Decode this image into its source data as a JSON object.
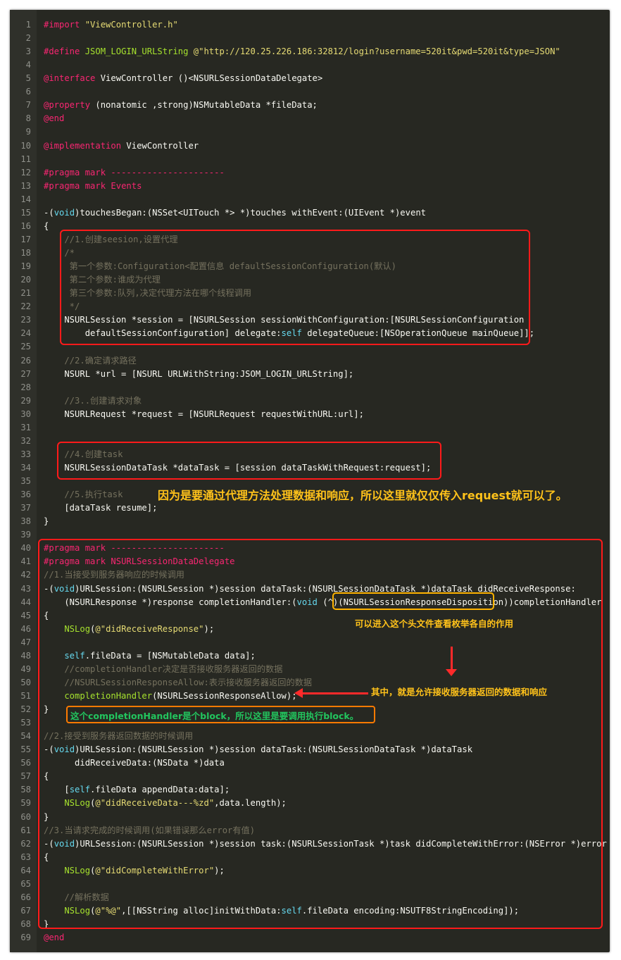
{
  "editor": {
    "theme_colors": {
      "background": "#272822",
      "preprocessor": "#f92672",
      "string": "#e6db74",
      "comment": "#75715e",
      "type": "#66d9ef",
      "function": "#a6e22e",
      "plain": "#f8f8f2"
    },
    "lines": [
      {
        "n": "1",
        "segs": [
          {
            "c": "t-pre",
            "t": "#import "
          },
          {
            "c": "t-str",
            "t": "\"ViewController.h\""
          }
        ]
      },
      {
        "n": "2",
        "segs": []
      },
      {
        "n": "3",
        "segs": [
          {
            "c": "t-pre",
            "t": "#define "
          },
          {
            "c": "t-fn",
            "t": "JSOM_LOGIN_URLString "
          },
          {
            "c": "t-str",
            "t": "@\"http://120.25.226.186:32812/login?username=520it&pwd=520it&type=JSON\""
          }
        ]
      },
      {
        "n": "4",
        "segs": []
      },
      {
        "n": "5",
        "segs": [
          {
            "c": "t-kw",
            "t": "@interface"
          },
          {
            "c": "t-plain",
            "t": " ViewController ()<NSURLSessionDataDelegate>"
          }
        ]
      },
      {
        "n": "6",
        "segs": []
      },
      {
        "n": "7",
        "segs": [
          {
            "c": "t-kw",
            "t": "@property"
          },
          {
            "c": "t-plain",
            "t": " (nonatomic ,strong)NSMutableData *fileData;"
          }
        ]
      },
      {
        "n": "8",
        "segs": [
          {
            "c": "t-kw",
            "t": "@end"
          }
        ]
      },
      {
        "n": "9",
        "segs": []
      },
      {
        "n": "10",
        "segs": [
          {
            "c": "t-kw",
            "t": "@implementation"
          },
          {
            "c": "t-plain",
            "t": " ViewController"
          }
        ]
      },
      {
        "n": "11",
        "segs": []
      },
      {
        "n": "12",
        "segs": [
          {
            "c": "t-pre",
            "t": "#pragma "
          },
          {
            "c": "t-kw",
            "t": "mark ----------------------"
          }
        ]
      },
      {
        "n": "13",
        "segs": [
          {
            "c": "t-pre",
            "t": "#pragma "
          },
          {
            "c": "t-kw",
            "t": "mark Events"
          }
        ]
      },
      {
        "n": "14",
        "segs": []
      },
      {
        "n": "15",
        "segs": [
          {
            "c": "t-plain",
            "t": "-("
          },
          {
            "c": "t-type",
            "t": "void"
          },
          {
            "c": "t-plain",
            "t": ")touchesBegan:(NSSet<UITouch *> *)touches withEvent:(UIEvent *)event"
          }
        ]
      },
      {
        "n": "16",
        "segs": [
          {
            "c": "t-plain",
            "t": "{"
          }
        ]
      },
      {
        "n": "17",
        "segs": [
          {
            "c": "t-com",
            "t": "    //1.创建seesion,设置代理"
          }
        ]
      },
      {
        "n": "18",
        "segs": [
          {
            "c": "t-com",
            "t": "    /*"
          }
        ]
      },
      {
        "n": "19",
        "segs": [
          {
            "c": "t-com",
            "t": "     第一个参数:Configuration<配置信息 defaultSessionConfiguration(默认)"
          }
        ]
      },
      {
        "n": "20",
        "segs": [
          {
            "c": "t-com",
            "t": "     第二个参数:谁成为代理"
          }
        ]
      },
      {
        "n": "21",
        "segs": [
          {
            "c": "t-com",
            "t": "     第三个参数:队列,决定代理方法在哪个线程调用"
          }
        ]
      },
      {
        "n": "22",
        "segs": [
          {
            "c": "t-com",
            "t": "     */"
          }
        ]
      },
      {
        "n": "23",
        "segs": [
          {
            "c": "t-plain",
            "t": "    NSURLSession *session = [NSURLSession sessionWithConfiguration:[NSURLSessionConfiguration"
          }
        ]
      },
      {
        "n": "24",
        "segs": [
          {
            "c": "t-plain",
            "t": "        defaultSessionConfiguration] delegate:"
          },
          {
            "c": "t-type",
            "t": "self"
          },
          {
            "c": "t-plain",
            "t": " delegateQueue:[NSOperationQueue mainQueue]];"
          }
        ]
      },
      {
        "n": "25",
        "segs": []
      },
      {
        "n": "26",
        "segs": [
          {
            "c": "t-com",
            "t": "    //2.确定请求路径"
          }
        ]
      },
      {
        "n": "27",
        "segs": [
          {
            "c": "t-plain",
            "t": "    NSURL *url = [NSURL URLWithString:JSOM_LOGIN_URLString];"
          }
        ]
      },
      {
        "n": "28",
        "segs": []
      },
      {
        "n": "29",
        "segs": [
          {
            "c": "t-com",
            "t": "    //3..创建请求对象"
          }
        ]
      },
      {
        "n": "30",
        "segs": [
          {
            "c": "t-plain",
            "t": "    NSURLRequest *request = [NSURLRequest requestWithURL:url];"
          }
        ]
      },
      {
        "n": "31",
        "segs": []
      },
      {
        "n": "32",
        "segs": []
      },
      {
        "n": "33",
        "segs": [
          {
            "c": "t-com",
            "t": "    //4.创建task"
          }
        ]
      },
      {
        "n": "34",
        "segs": [
          {
            "c": "t-plain",
            "t": "    NSURLSessionDataTask *dataTask = [session dataTaskWithRequest:request];"
          }
        ]
      },
      {
        "n": "35",
        "segs": []
      },
      {
        "n": "36",
        "segs": [
          {
            "c": "t-com",
            "t": "    //5.执行task"
          }
        ]
      },
      {
        "n": "37",
        "segs": [
          {
            "c": "t-plain",
            "t": "    [dataTask resume];"
          }
        ]
      },
      {
        "n": "38",
        "segs": [
          {
            "c": "t-plain",
            "t": "}"
          }
        ]
      },
      {
        "n": "39",
        "segs": []
      },
      {
        "n": "40",
        "segs": [
          {
            "c": "t-pre",
            "t": "#pragma "
          },
          {
            "c": "t-kw",
            "t": "mark ----------------------"
          }
        ]
      },
      {
        "n": "41",
        "segs": [
          {
            "c": "t-pre",
            "t": "#pragma "
          },
          {
            "c": "t-kw",
            "t": "mark NSURLSessionDataDelegate"
          }
        ]
      },
      {
        "n": "42",
        "segs": [
          {
            "c": "t-com",
            "t": "//1.当接受到服务器响应的时候调用"
          }
        ]
      },
      {
        "n": "43",
        "segs": [
          {
            "c": "t-plain",
            "t": "-("
          },
          {
            "c": "t-type",
            "t": "void"
          },
          {
            "c": "t-plain",
            "t": ")URLSession:(NSURLSession *)session dataTask:(NSURLSessionDataTask *)dataTask didReceiveResponse:"
          }
        ]
      },
      {
        "n": "44",
        "segs": [
          {
            "c": "t-plain",
            "t": "    (NSURLResponse *)response completionHandler:("
          },
          {
            "c": "t-type",
            "t": "void"
          },
          {
            "c": "t-plain",
            "t": " (^)(NSURLSessionResponseDisposition))completionHandler"
          }
        ]
      },
      {
        "n": "45",
        "segs": [
          {
            "c": "t-plain",
            "t": "{"
          }
        ]
      },
      {
        "n": "46",
        "segs": [
          {
            "c": "t-fn",
            "t": "    NSLog"
          },
          {
            "c": "t-plain",
            "t": "("
          },
          {
            "c": "t-str",
            "t": "@\"didReceiveResponse\""
          },
          {
            "c": "t-plain",
            "t": ");"
          }
        ]
      },
      {
        "n": "47",
        "segs": []
      },
      {
        "n": "48",
        "segs": [
          {
            "c": "t-type",
            "t": "    self"
          },
          {
            "c": "t-plain",
            "t": ".fileData = [NSMutableData data];"
          }
        ]
      },
      {
        "n": "49",
        "segs": [
          {
            "c": "t-com",
            "t": "    //completionHandler决定是否接收服务器返回的数据"
          }
        ]
      },
      {
        "n": "50",
        "segs": [
          {
            "c": "t-com",
            "t": "    //NSURLSessionResponseAllow:表示接收服务器返回的数据"
          }
        ]
      },
      {
        "n": "51",
        "segs": [
          {
            "c": "t-fn",
            "t": "    completionHandler"
          },
          {
            "c": "t-plain",
            "t": "(NSURLSessionResponseAllow);"
          }
        ]
      },
      {
        "n": "52",
        "segs": [
          {
            "c": "t-plain",
            "t": "}"
          }
        ]
      },
      {
        "n": "53",
        "segs": []
      },
      {
        "n": "54",
        "segs": [
          {
            "c": "t-com",
            "t": "//2.接受到服务器返回数据的时候调用"
          }
        ]
      },
      {
        "n": "55",
        "segs": [
          {
            "c": "t-plain",
            "t": "-("
          },
          {
            "c": "t-type",
            "t": "void"
          },
          {
            "c": "t-plain",
            "t": ")URLSession:(NSURLSession *)session dataTask:(NSURLSessionDataTask *)dataTask"
          }
        ]
      },
      {
        "n": "56",
        "segs": [
          {
            "c": "t-plain",
            "t": "      didReceiveData:(NSData *)data"
          }
        ]
      },
      {
        "n": "57",
        "segs": [
          {
            "c": "t-plain",
            "t": "{"
          }
        ]
      },
      {
        "n": "58",
        "segs": [
          {
            "c": "t-plain",
            "t": "    ["
          },
          {
            "c": "t-type",
            "t": "self"
          },
          {
            "c": "t-plain",
            "t": ".fileData appendData:data];"
          }
        ]
      },
      {
        "n": "59",
        "segs": [
          {
            "c": "t-fn",
            "t": "    NSLog"
          },
          {
            "c": "t-plain",
            "t": "("
          },
          {
            "c": "t-str",
            "t": "@\"didReceiveData---%zd\""
          },
          {
            "c": "t-plain",
            "t": ",data.length);"
          }
        ]
      },
      {
        "n": "60",
        "segs": [
          {
            "c": "t-plain",
            "t": "}"
          }
        ]
      },
      {
        "n": "61",
        "segs": [
          {
            "c": "t-com",
            "t": "//3.当请求完成的时候调用(如果错误那么error有值)"
          }
        ]
      },
      {
        "n": "62",
        "segs": [
          {
            "c": "t-plain",
            "t": "-("
          },
          {
            "c": "t-type",
            "t": "void"
          },
          {
            "c": "t-plain",
            "t": ")URLSession:(NSURLSession *)session task:(NSURLSessionTask *)task didCompleteWithError:(NSError *)error"
          }
        ]
      },
      {
        "n": "63",
        "segs": [
          {
            "c": "t-plain",
            "t": "{"
          }
        ]
      },
      {
        "n": "64",
        "segs": [
          {
            "c": "t-fn",
            "t": "    NSLog"
          },
          {
            "c": "t-plain",
            "t": "("
          },
          {
            "c": "t-str",
            "t": "@\"didCompleteWithError\""
          },
          {
            "c": "t-plain",
            "t": ");"
          }
        ]
      },
      {
        "n": "65",
        "segs": []
      },
      {
        "n": "66",
        "segs": [
          {
            "c": "t-com",
            "t": "    //解析数据"
          }
        ]
      },
      {
        "n": "67",
        "segs": [
          {
            "c": "t-fn",
            "t": "    NSLog"
          },
          {
            "c": "t-plain",
            "t": "("
          },
          {
            "c": "t-str",
            "t": "@\"%@\""
          },
          {
            "c": "t-plain",
            "t": ",[[NSString alloc]initWithData:"
          },
          {
            "c": "t-type",
            "t": "self"
          },
          {
            "c": "t-plain",
            "t": ".fileData encoding:NSUTF8StringEncoding]);"
          }
        ]
      },
      {
        "n": "68",
        "segs": [
          {
            "c": "t-plain",
            "t": "}"
          }
        ]
      },
      {
        "n": "69",
        "segs": [
          {
            "c": "t-kw",
            "t": "@end"
          }
        ]
      }
    ]
  },
  "annotations": {
    "note_delegate": "因为是要通过代理方法处理数据和响应，所以这里就仅仅传入request就可以了。",
    "note_header": "可以进入这个头文件查看枚举各自的作用",
    "note_allow": "其中，就是允许接收服务器返回的数据和响应",
    "note_block": "这个completionHandler是个block，所以这里是要调用执行block。",
    "note_colors": {
      "yellow": "#ffc21a",
      "green": "#22c55e",
      "red_box": "#ff1a1a",
      "orange_box": "#ff7a00"
    }
  }
}
